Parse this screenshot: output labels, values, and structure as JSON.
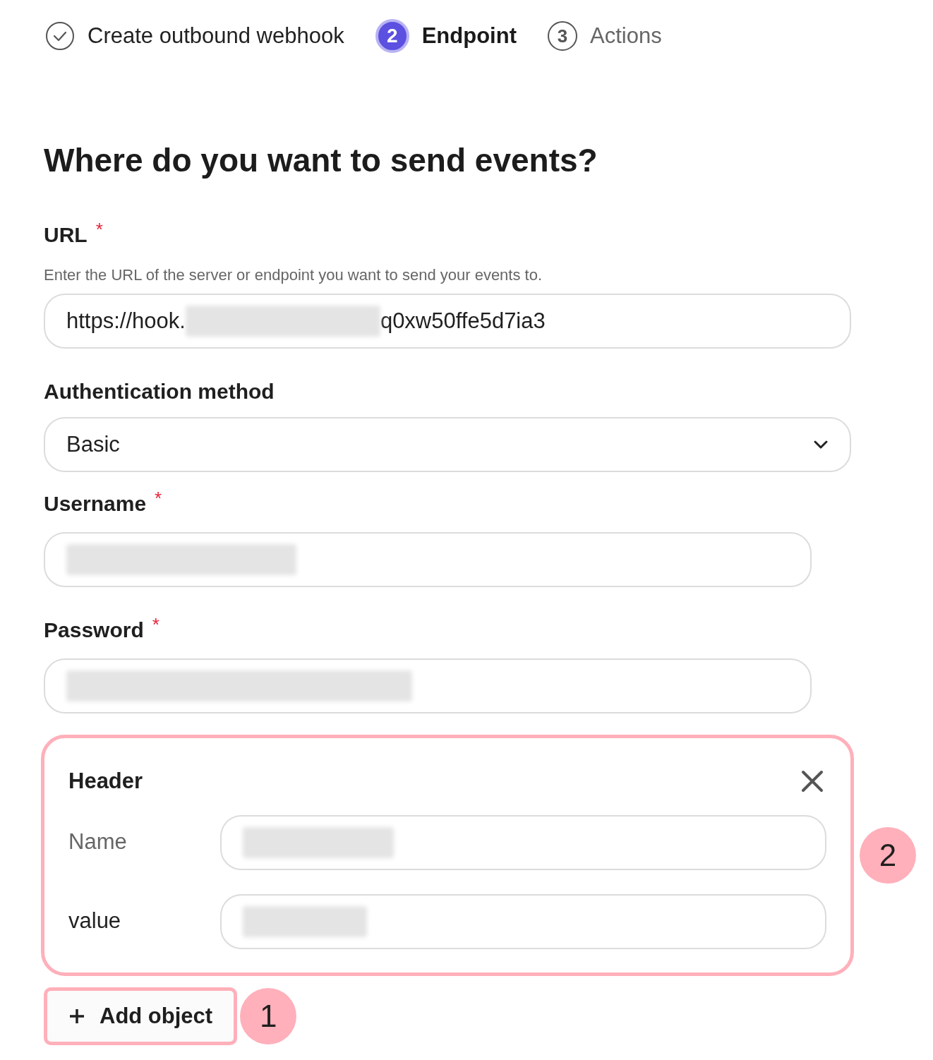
{
  "steps": [
    {
      "label": "Create outbound webhook",
      "completed": true,
      "selected": false
    },
    {
      "number": "2",
      "label": "Endpoint",
      "completed": false,
      "selected": true
    },
    {
      "number": "3",
      "label": "Actions",
      "completed": false,
      "selected": false
    }
  ],
  "heading": "Where do you want to send events?",
  "url": {
    "label": "URL",
    "required_mark": "*",
    "description": "Enter the URL of the server or endpoint you want to send your events to.",
    "value_start": "https://hook.",
    "value_end": "q0xw50ffe5d7ia3",
    "redacted": true
  },
  "auth": {
    "label": "Authentication method",
    "value": "Basic"
  },
  "username": {
    "label": "Username",
    "required_mark": "*",
    "redacted": true
  },
  "password": {
    "label": "Password",
    "required_mark": "*",
    "redacted": true
  },
  "header": {
    "title": "Header",
    "highlighted": true,
    "callout": "2",
    "rows": [
      {
        "label": "Name",
        "redacted": true
      },
      {
        "label": "value",
        "redacted": true
      }
    ]
  },
  "add_button": {
    "label": "Add object",
    "highlighted": true,
    "callout": "1"
  }
}
